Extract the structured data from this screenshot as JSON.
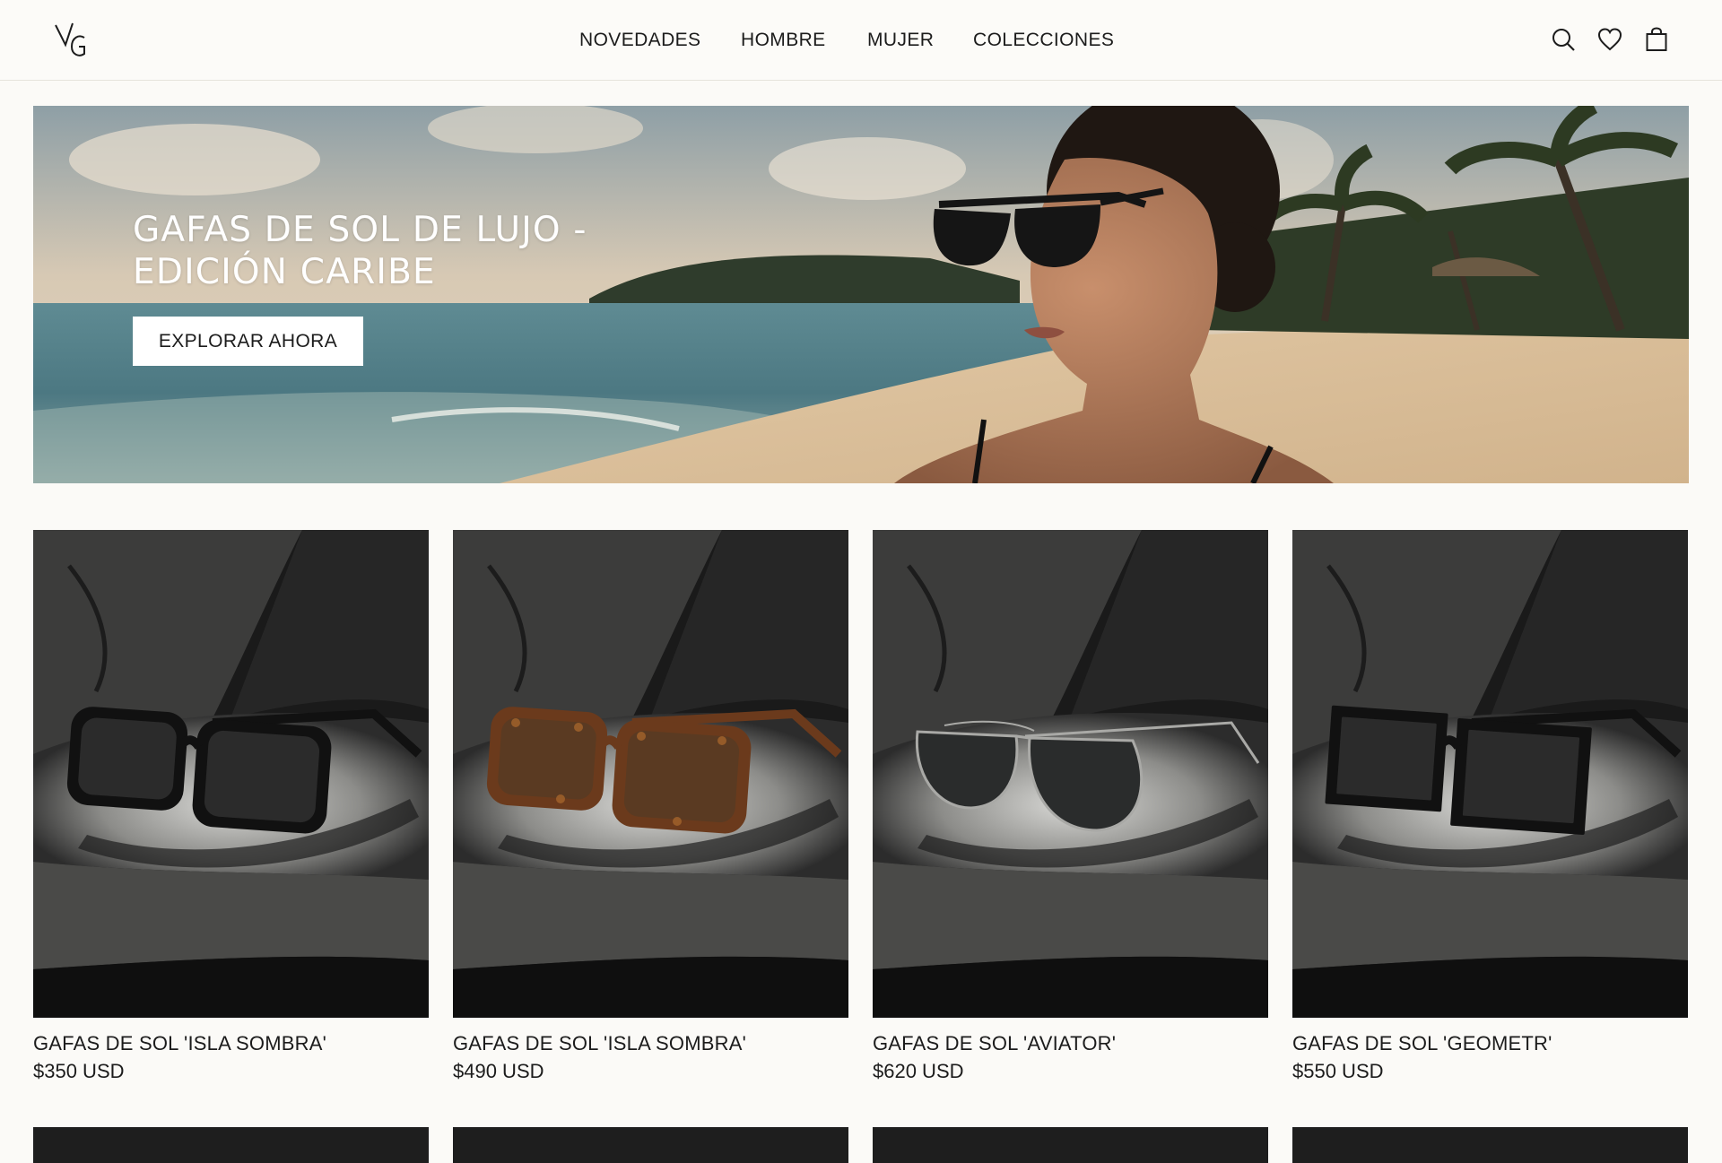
{
  "header": {
    "logo_text": "VG",
    "nav": [
      "NOVEDADES",
      "HOMBRE",
      "MUJER",
      "COLECCIONES"
    ],
    "icons": [
      "search-icon",
      "heart-icon",
      "bag-icon"
    ]
  },
  "hero": {
    "title": "GAFAS DE SOL DE LUJO - EDICIÓN CARIBE",
    "cta": "EXPLORAR AHORA"
  },
  "products": [
    {
      "name": "GAFAS DE SOL 'ISLA SOMBRA'",
      "price": "$350 USD",
      "frame": "black"
    },
    {
      "name": "GAFAS DE SOL 'ISLA SOMBRA'",
      "price": "$490 USD",
      "frame": "tortoise"
    },
    {
      "name": "GAFAS DE SOL 'AVIATOR'",
      "price": "$620 USD",
      "frame": "aviator"
    },
    {
      "name": "GAFAS DE SOL 'GEOMETR'",
      "price": "$550 USD",
      "frame": "geometric"
    }
  ],
  "colors": {
    "background": "#fbfaf7",
    "text": "#1c1c1c",
    "product_bg": "#2a2a2a"
  }
}
